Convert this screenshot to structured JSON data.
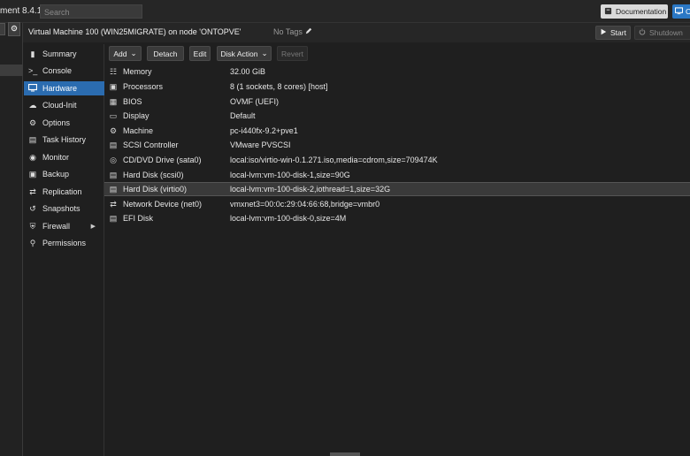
{
  "topbar": {
    "brand": "ment 8.4.1",
    "search_placeholder": "Search",
    "documentation_label": "Documentation",
    "create_label": "C"
  },
  "vm": {
    "title": "Virtual Machine 100 (WIN25MIGRATE) on node 'ONTOPVE'",
    "tags_label": "No Tags",
    "start_label": "Start",
    "shutdown_label": "Shutdown"
  },
  "nav": {
    "items": [
      {
        "label": "Summary",
        "icon": "book-icon"
      },
      {
        "label": "Console",
        "icon": "terminal-icon"
      },
      {
        "label": "Hardware",
        "icon": "monitor-icon",
        "active": true
      },
      {
        "label": "Cloud-Init",
        "icon": "cloud-icon"
      },
      {
        "label": "Options",
        "icon": "gear-icon"
      },
      {
        "label": "Task History",
        "icon": "list-icon"
      },
      {
        "label": "Monitor",
        "icon": "eye-icon"
      },
      {
        "label": "Backup",
        "icon": "save-icon"
      },
      {
        "label": "Replication",
        "icon": "retweet-icon"
      },
      {
        "label": "Snapshots",
        "icon": "history-icon"
      },
      {
        "label": "Firewall",
        "icon": "shield-icon"
      },
      {
        "label": "Permissions",
        "icon": "unlock-icon"
      }
    ]
  },
  "toolbar": {
    "add_label": "Add",
    "detach_label": "Detach",
    "edit_label": "Edit",
    "disk_action_label": "Disk Action",
    "revert_label": "Revert"
  },
  "hardware": {
    "rows": [
      {
        "key": "Memory",
        "value": "32.00 GiB",
        "icon": "memory-icon"
      },
      {
        "key": "Processors",
        "value": "8 (1 sockets, 8 cores) [host]",
        "icon": "cpu-icon"
      },
      {
        "key": "BIOS",
        "value": "OVMF (UEFI)",
        "icon": "microchip-icon"
      },
      {
        "key": "Display",
        "value": "Default",
        "icon": "desktop-icon"
      },
      {
        "key": "Machine",
        "value": "pc-i440fx-9.2+pve1",
        "icon": "cogs-icon"
      },
      {
        "key": "SCSI Controller",
        "value": "VMware PVSCSI",
        "icon": "database-icon"
      },
      {
        "key": "CD/DVD Drive (sata0)",
        "value": "local:iso/virtio-win-0.1.271.iso,media=cdrom,size=709474K",
        "icon": "cdrom-icon"
      },
      {
        "key": "Hard Disk (scsi0)",
        "value": "local-lvm:vm-100-disk-1,size=90G",
        "icon": "hdd-icon"
      },
      {
        "key": "Hard Disk (virtio0)",
        "value": "local-lvm:vm-100-disk-2,iothread=1,size=32G",
        "icon": "hdd-icon",
        "selected": true
      },
      {
        "key": "Network Device (net0)",
        "value": "vmxnet3=00:0c:29:04:66:68,bridge=vmbr0",
        "icon": "exchange-icon"
      },
      {
        "key": "EFI Disk",
        "value": "local-lvm:vm-100-disk-0,size=4M",
        "icon": "hdd-icon"
      }
    ]
  }
}
